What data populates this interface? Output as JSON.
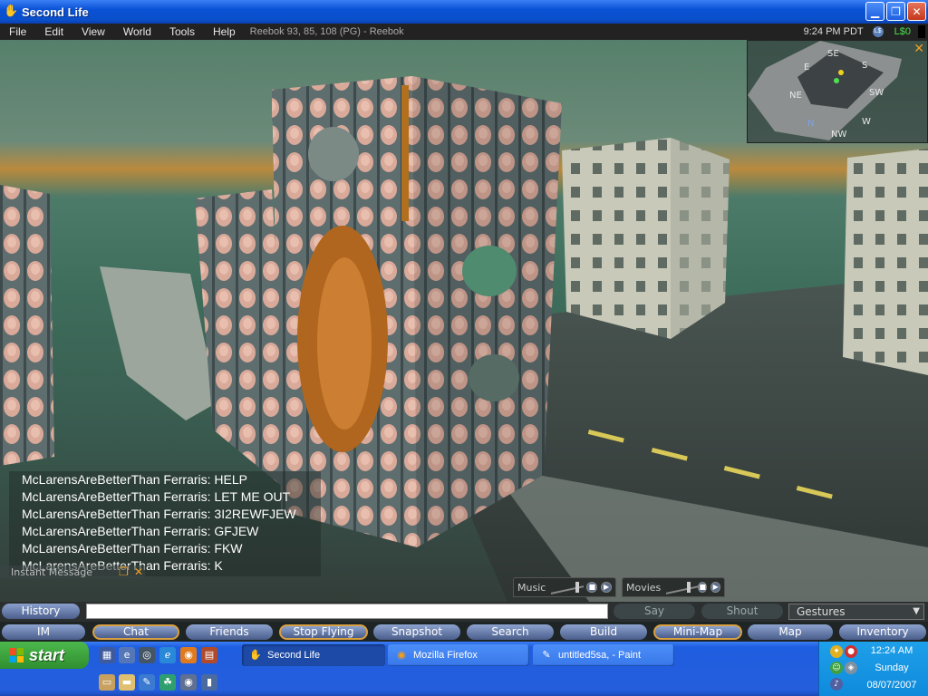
{
  "window": {
    "title": "Second Life"
  },
  "menu": {
    "items": [
      "File",
      "Edit",
      "View",
      "World",
      "Tools",
      "Help"
    ],
    "location": "Reebok 93, 85, 108 (PG) - Reebok",
    "clock": "9:24 PM PDT",
    "currency_icon": "L$",
    "balance": "L$0"
  },
  "minimap": {
    "directions": {
      "n": "N",
      "ne": "NE",
      "e": "E",
      "se": "SE",
      "s": "S",
      "sw": "SW",
      "w": "W",
      "nw": "NW"
    }
  },
  "chat": {
    "lines": [
      "McLarensAreBetterThan Ferraris: HELP",
      "McLarensAreBetterThan Ferraris: LET ME OUT",
      "McLarensAreBetterThan Ferraris: 3I2REWFJEW",
      "McLarensAreBetterThan Ferraris: GFJEW",
      "McLarensAreBetterThan Ferraris: FKW",
      "McLarensAreBetterThan Ferraris: K"
    ],
    "im_label": "Instant Message"
  },
  "media": {
    "music_label": "Music",
    "movies_label": "Movies"
  },
  "chatbar": {
    "history": "History",
    "input_value": "",
    "say": "Say",
    "shout": "Shout",
    "gestures": "Gestures"
  },
  "toolbar": {
    "buttons": [
      "IM",
      "Chat",
      "Friends",
      "Stop Flying",
      "Snapshot",
      "Search",
      "Build",
      "Mini-Map",
      "Map",
      "Inventory"
    ]
  },
  "taskbar": {
    "start": "start",
    "tasks": [
      "Second Life",
      "Mozilla Firefox",
      "untitled5sa, - Paint"
    ],
    "time": "12:24 AM",
    "day": "Sunday",
    "date": "08/07/2007"
  }
}
